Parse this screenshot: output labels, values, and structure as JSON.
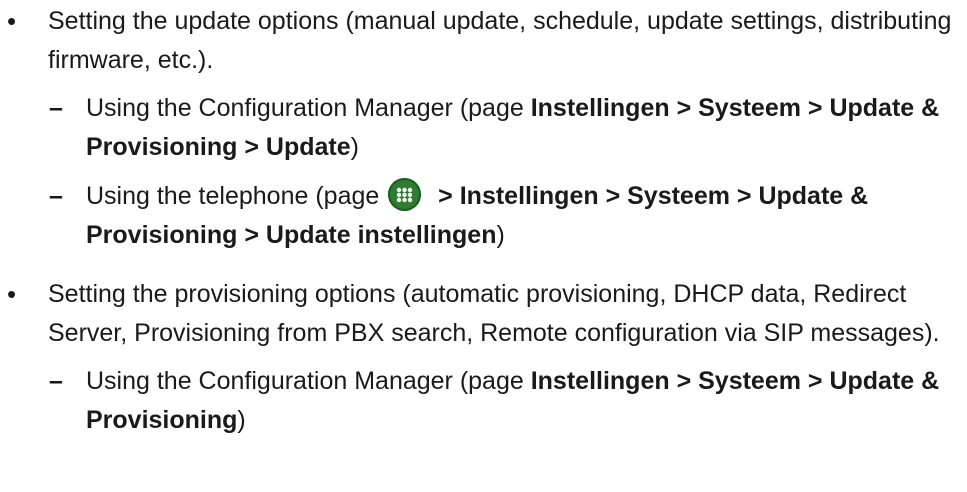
{
  "items": [
    {
      "text": "Setting the update options (manual update, schedule, update settings, distributing firmware, etc.).",
      "sub": [
        {
          "prefix": "Using the Configuration Manager (page ",
          "path": "Instellingen > Systeem > Update & Provisioning > Update",
          "suffix": ")"
        },
        {
          "prefix": "Using the telephone (page ",
          "icon": "apps-grid-icon",
          "path": " > Instellingen > Systeem > Update & Provisioning > Update instellingen",
          "suffix": ")"
        }
      ]
    },
    {
      "text": "Setting the provisioning options (automatic provisioning, DHCP data, Redirect Server, Provisioning from PBX search, Remote configuration via SIP messages).",
      "sub": [
        {
          "prefix": "Using the Configuration Manager (page ",
          "path": "Instellingen > Systeem > Update & Provisioning",
          "suffix": ")"
        }
      ]
    }
  ],
  "bullet_char": "•",
  "dash_char": "–",
  "colors": {
    "text": "#1a1a1a",
    "icon_bg": "#2e7d32"
  }
}
